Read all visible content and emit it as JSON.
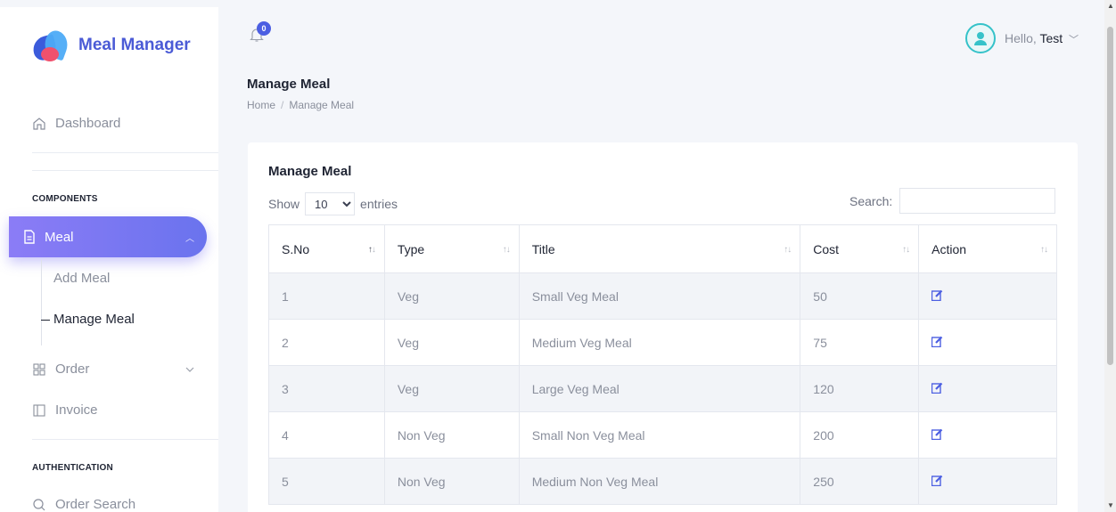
{
  "brand": {
    "name": "Meal Manager"
  },
  "sidebar": {
    "dashboard": "Dashboard",
    "components_label": "COMPONENTS",
    "meal": "Meal",
    "add_meal": "Add Meal",
    "manage_meal": "Manage Meal",
    "order": "Order",
    "invoice": "Invoice",
    "auth_label": "AUTHENTICATION",
    "order_search": "Order Search"
  },
  "header": {
    "notification_count": "0",
    "greeting": "Hello,",
    "user_name": "Test"
  },
  "page": {
    "title": "Manage Meal",
    "breadcrumb": {
      "home": "Home",
      "separator": "/",
      "current": "Manage Meal"
    }
  },
  "card": {
    "title": "Manage Meal",
    "show_label": "Show",
    "entries_value": "10",
    "entries_label": "entries",
    "search_label": "Search:",
    "search_value": ""
  },
  "table": {
    "columns": [
      "S.No",
      "Type",
      "Title",
      "Cost",
      "Action"
    ],
    "rows": [
      {
        "sno": "1",
        "type": "Veg",
        "title": "Small Veg Meal",
        "cost": "50"
      },
      {
        "sno": "2",
        "type": "Veg",
        "title": "Medium Veg Meal",
        "cost": "75"
      },
      {
        "sno": "3",
        "type": "Veg",
        "title": "Large Veg Meal",
        "cost": "120"
      },
      {
        "sno": "4",
        "type": "Non Veg",
        "title": "Small Non Veg Meal",
        "cost": "200"
      },
      {
        "sno": "5",
        "type": "Non Veg",
        "title": "Medium Non Veg Meal",
        "cost": "250"
      }
    ]
  },
  "colors": {
    "accent": "#6a73ee",
    "brand": "#4b5bd6",
    "edit_icon": "#4c5fe2"
  },
  "icons": {
    "dashboard": "home-icon",
    "meal": "file-icon",
    "order": "grid-icon",
    "invoice": "panel-icon",
    "order_search": "search-icon",
    "bell": "bell-icon",
    "user": "user-icon",
    "edit": "edit-icon"
  }
}
